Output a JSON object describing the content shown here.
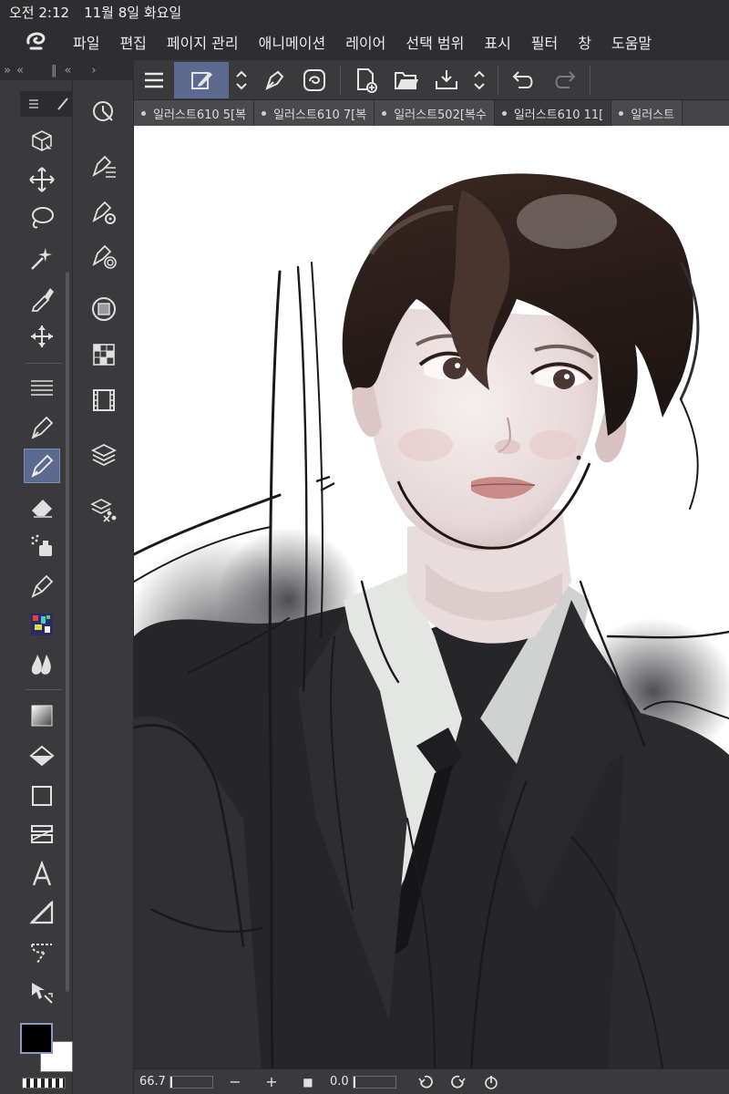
{
  "status": {
    "time": "오전 2:12",
    "date": "11월 8일 화요일"
  },
  "menu": {
    "items": [
      "파일",
      "편집",
      "페이지 관리",
      "애니메이션",
      "레이어",
      "선택 범위",
      "표시",
      "필터",
      "창",
      "도움말"
    ]
  },
  "collapse": {
    "left_a": "»",
    "left_b": "«",
    "mid_a": "‖",
    "mid_b": "«",
    "right": "›"
  },
  "tabs": [
    {
      "label": "일러스트610 5[복"
    },
    {
      "label": "일러스트610 7[복"
    },
    {
      "label": "일러스트502[복수"
    },
    {
      "label": "일러스트610 11["
    },
    {
      "label": "일러스트"
    }
  ],
  "bottom": {
    "zoom": "66.7",
    "minus": "−",
    "plus": "+",
    "stop": "■",
    "rotation": "0.0"
  },
  "colors": {
    "accent": "#5b6a8e",
    "main_color": "#000000",
    "sub_color": "#ffffff"
  },
  "icons": {
    "tools": [
      "object-select-icon",
      "move-icon",
      "lasso-icon",
      "magic-wand-icon",
      "eyedropper-icon",
      "transform-move-icon",
      "hatch-lines-icon",
      "pen-icon",
      "pencil-icon",
      "eraser-icon",
      "airbrush-icon",
      "fountain-pen-icon",
      "decoration-icon",
      "blend-icon",
      "gradient-icon",
      "fill-icon",
      "rectangle-icon",
      "frame-icon",
      "text-icon",
      "ruler-icon",
      "balloon-icon",
      "operation-icon"
    ],
    "palettes": [
      "navigator-icon",
      "sub-tool-icon",
      "tool-property-icon",
      "brush-size-icon",
      "color-wheel-icon",
      "color-set-icon",
      "timeline-icon",
      "layer-icon",
      "material-icon"
    ]
  }
}
